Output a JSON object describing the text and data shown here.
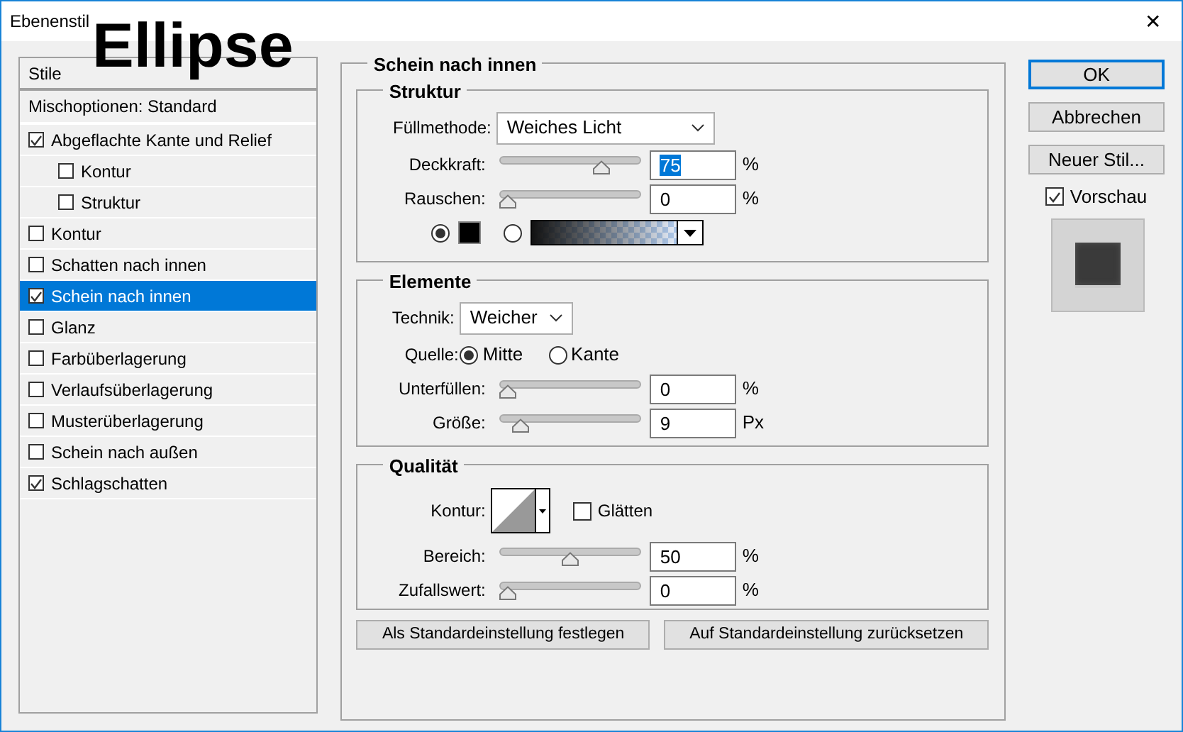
{
  "window": {
    "title": "Ebenenstil",
    "close": "✕"
  },
  "annotation": "Ellipse",
  "styles_panel": {
    "header": "Stile",
    "blend_options": "Mischoptionen: Standard",
    "items": [
      {
        "label": "Abgeflachte Kante und Relief",
        "checked": true,
        "selected": false,
        "children": [
          {
            "label": "Kontur",
            "checked": false,
            "selected": false
          },
          {
            "label": "Struktur",
            "checked": false,
            "selected": false
          }
        ]
      },
      {
        "label": "Kontur",
        "checked": false,
        "selected": false
      },
      {
        "label": "Schatten nach innen",
        "checked": false,
        "selected": false
      },
      {
        "label": "Schein nach innen",
        "checked": true,
        "selected": true
      },
      {
        "label": "Glanz",
        "checked": false,
        "selected": false
      },
      {
        "label": "Farbüberlagerung",
        "checked": false,
        "selected": false
      },
      {
        "label": "Verlaufsüberlagerung",
        "checked": false,
        "selected": false
      },
      {
        "label": "Musterüberlagerung",
        "checked": false,
        "selected": false
      },
      {
        "label": "Schein nach außen",
        "checked": false,
        "selected": false
      },
      {
        "label": "Schlagschatten",
        "checked": true,
        "selected": false
      }
    ]
  },
  "effect": {
    "title": "Schein nach innen",
    "structure": {
      "title": "Struktur",
      "blend_mode": {
        "label": "Füllmethode:",
        "value": "Weiches Licht"
      },
      "sliders": [
        {
          "label": "Deckkraft:",
          "level": 0.75,
          "value": "75",
          "unit": "%",
          "highlighted": true
        },
        {
          "label": "Rauschen:",
          "level": 0,
          "value": "0",
          "unit": "%",
          "highlighted": false
        }
      ],
      "color_source": [
        {
          "kind": "swatch",
          "selected": true
        },
        {
          "kind": "gradient",
          "selected": false
        }
      ]
    },
    "elements": {
      "title": "Elemente",
      "technique": {
        "label": "Technik:",
        "value": "Weicher"
      },
      "source": {
        "label": "Quelle:",
        "options": [
          {
            "label": "Mitte",
            "selected": true
          },
          {
            "label": "Kante",
            "selected": false
          }
        ]
      },
      "sliders": [
        {
          "label": "Unterfüllen:",
          "level": 0,
          "value": "0",
          "unit": "%",
          "highlighted": false
        },
        {
          "label": "Größe:",
          "level": 0.1,
          "value": "9",
          "unit": "Px",
          "highlighted": false
        }
      ]
    },
    "quality": {
      "title": "Qualität",
      "contour": {
        "label": "Kontur:"
      },
      "antialias": {
        "label": "Glätten",
        "checked": false
      },
      "sliders": [
        {
          "label": "Bereich:",
          "level": 0.5,
          "value": "50",
          "unit": "%",
          "highlighted": false
        },
        {
          "label": "Zufallswert:",
          "level": 0,
          "value": "0",
          "unit": "%",
          "highlighted": false
        }
      ]
    },
    "bottom_buttons": [
      "Als Standardeinstellung festlegen",
      "Auf Standardeinstellung zurücksetzen"
    ]
  },
  "actions": [
    {
      "label": "OK",
      "default": true
    },
    {
      "label": "Abbrechen",
      "default": false
    },
    {
      "label": "Neuer Stil...",
      "default": false
    }
  ],
  "preview": {
    "label": "Vorschau",
    "checked": true
  }
}
